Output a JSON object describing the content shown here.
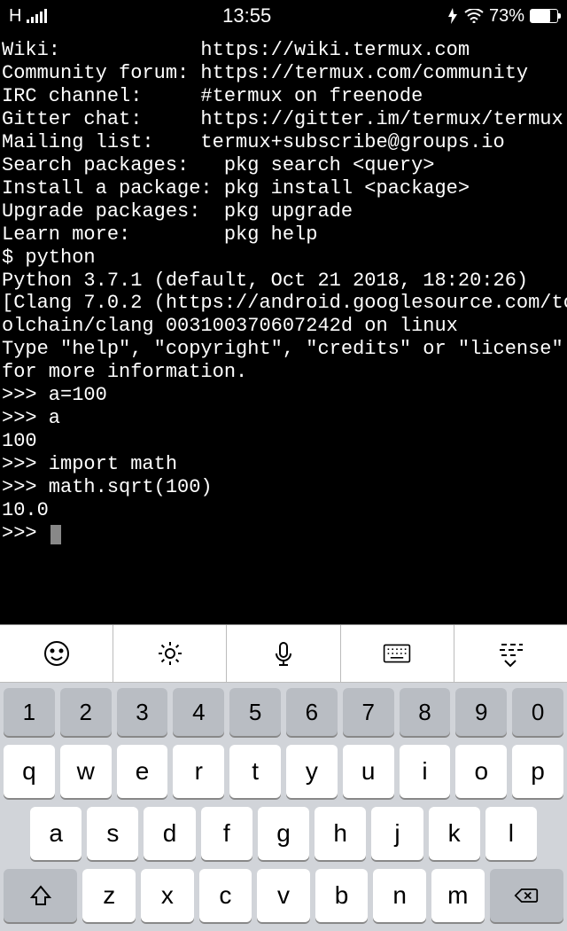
{
  "status": {
    "carrier": "H",
    "time": "13:55",
    "battery_pct": "73%"
  },
  "terminal": {
    "lines": [
      "Wiki:            https://wiki.termux.com",
      "Community forum: https://termux.com/community",
      "IRC channel:     #termux on freenode",
      "Gitter chat:     https://gitter.im/termux/termux",
      "Mailing list:    termux+subscribe@groups.io",
      "",
      "Search packages:   pkg search <query>",
      "Install a package: pkg install <package>",
      "Upgrade packages:  pkg upgrade",
      "Learn more:        pkg help",
      "$ python",
      "Python 3.7.1 (default, Oct 21 2018, 18:20:26)",
      "[Clang 7.0.2 (https://android.googlesource.com/to",
      "olchain/clang 003100370607242d on linux",
      "Type \"help\", \"copyright\", \"credits\" or \"license\"",
      "for more information.",
      ">>> a=100",
      ">>> a",
      "100",
      ">>> import math",
      ">>> math.sqrt(100)",
      "10.0",
      ">>> "
    ]
  },
  "keyboard": {
    "row_numbers": [
      "1",
      "2",
      "3",
      "4",
      "5",
      "6",
      "7",
      "8",
      "9",
      "0"
    ],
    "row_letters1": [
      "q",
      "w",
      "e",
      "r",
      "t",
      "y",
      "u",
      "i",
      "o",
      "p"
    ],
    "row_letters2": [
      "a",
      "s",
      "d",
      "f",
      "g",
      "h",
      "j",
      "k",
      "l"
    ],
    "row_letters3": [
      "z",
      "x",
      "c",
      "v",
      "b",
      "n",
      "m"
    ]
  }
}
